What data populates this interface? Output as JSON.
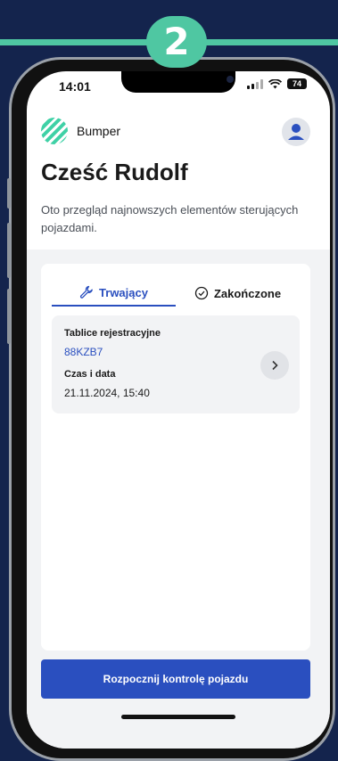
{
  "step": {
    "number": "2"
  },
  "status_bar": {
    "time": "14:01",
    "battery": "74"
  },
  "header": {
    "brand": "Bumper"
  },
  "greeting": "Cześć Rudolf",
  "subtitle": "Oto przegląd najnowszych elementów sterujących pojazdami.",
  "tabs": [
    {
      "label": "Trwający",
      "active": true,
      "icon": "wrench-icon"
    },
    {
      "label": "Zakończone",
      "active": false,
      "icon": "check-circle-icon"
    }
  ],
  "inspection": {
    "plate_label": "Tablice rejestracyjne",
    "plate": "88KZB7",
    "datetime_label": "Czas i data",
    "datetime": "21.11.2024, 15:40"
  },
  "cta": {
    "label": "Rozpocznij kontrolę pojazdu"
  },
  "colors": {
    "accent": "#2a4fbf",
    "brand_green": "#4fc7a2",
    "background": "#14244d"
  }
}
